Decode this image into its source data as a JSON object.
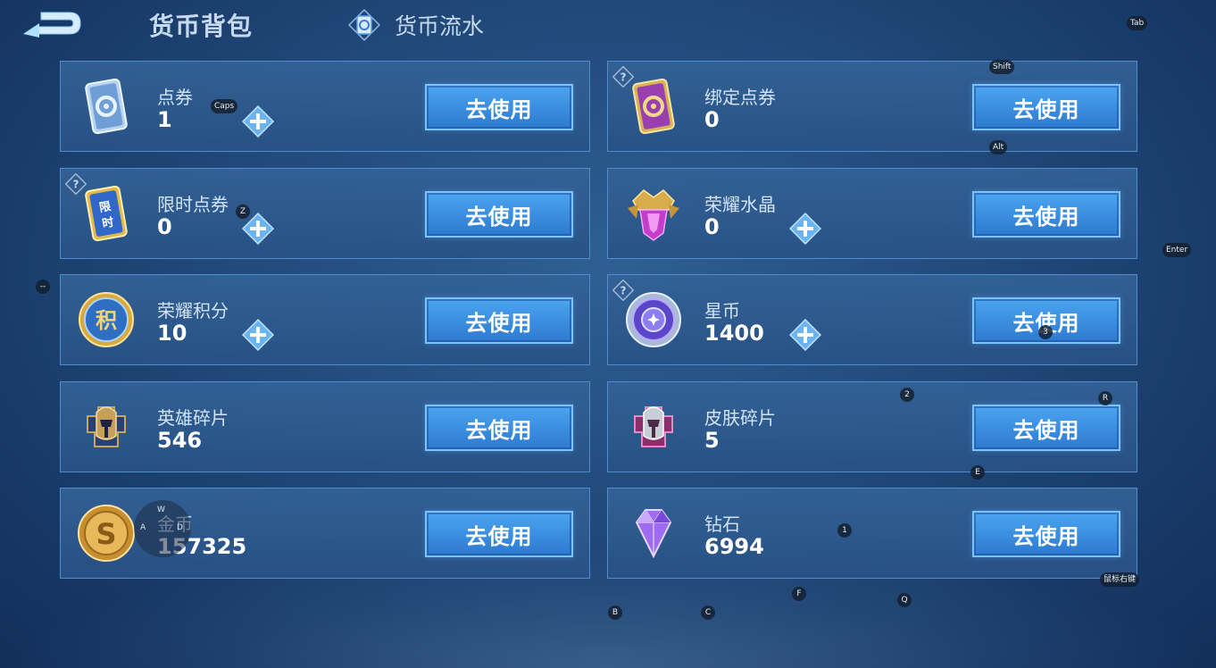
{
  "header": {
    "back_icon": "back-arrow-icon",
    "tab_wallet": "货币背包",
    "tab_flow": "货币流水",
    "flow_icon": "currency-ticket-icon"
  },
  "cards": [
    {
      "name": "点券",
      "value": "1",
      "icon": "voucher-ticket-icon",
      "has_plus": true,
      "has_help": false,
      "button": "去使用"
    },
    {
      "name": "绑定点券",
      "value": "0",
      "icon": "bound-voucher-icon",
      "has_plus": false,
      "has_help": true,
      "button": "去使用"
    },
    {
      "name": "限时点券",
      "value": "0",
      "icon": "limited-voucher-icon",
      "has_plus": true,
      "has_help": true,
      "button": "去使用"
    },
    {
      "name": "荣耀水晶",
      "value": "0",
      "icon": "glory-crystal-icon",
      "has_plus": true,
      "has_help": false,
      "button": "去使用"
    },
    {
      "name": "荣耀积分",
      "value": "10",
      "icon": "glory-points-icon",
      "has_plus": true,
      "has_help": false,
      "button": "去使用"
    },
    {
      "name": "星币",
      "value": "1400",
      "icon": "star-coin-icon",
      "has_plus": true,
      "has_help": true,
      "button": "去使用"
    },
    {
      "name": "英雄碎片",
      "value": "546",
      "icon": "hero-fragment-icon",
      "has_plus": false,
      "has_help": false,
      "button": "去使用"
    },
    {
      "name": "皮肤碎片",
      "value": "5",
      "icon": "skin-fragment-icon",
      "has_plus": false,
      "has_help": false,
      "button": "去使用"
    },
    {
      "name": "金币",
      "value": "157325",
      "icon": "gold-coin-icon",
      "has_plus": false,
      "has_help": false,
      "button": "去使用"
    },
    {
      "name": "钻石",
      "value": "6994",
      "icon": "diamond-icon",
      "has_plus": false,
      "has_help": false,
      "button": "去使用"
    }
  ],
  "key_hints": {
    "tab": "Tab",
    "shift": "Shift",
    "alt": "Alt",
    "caps": "Caps",
    "z": "Z",
    "enter": "Enter",
    "dash": "--",
    "three": "3",
    "two": "2",
    "r": "R",
    "e": "E",
    "one": "1",
    "right_click": "鼠标右键",
    "f": "F",
    "q": "Q",
    "b": "B",
    "c": "C",
    "w": "W",
    "a": "A",
    "d": "D"
  },
  "colors": {
    "background": "#21497a",
    "card_border": "#4f8dcc",
    "button": "#3d92e4",
    "text": "#ffffff"
  }
}
